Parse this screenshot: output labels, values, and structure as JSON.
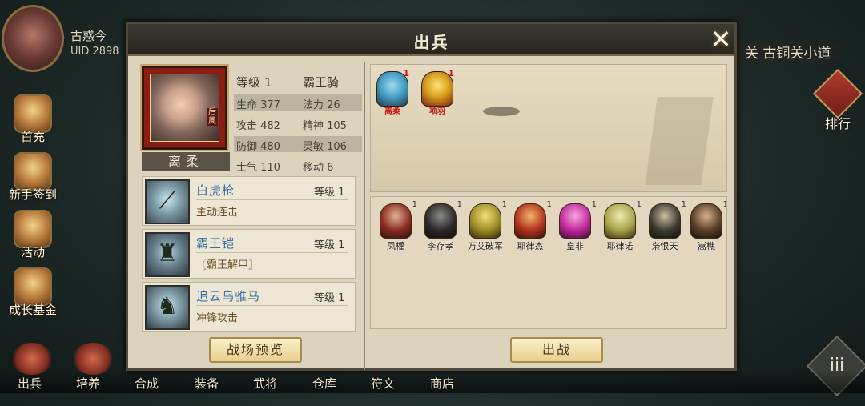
{
  "hud": {
    "player_name": "古惑今",
    "player_uid": "UID 2898",
    "location": "关 古铜关小道",
    "side_buttons": [
      "首充",
      "新手签到",
      "活动",
      "成长基金"
    ],
    "rank_label": "排行",
    "menu_icon": "iii",
    "bottom_nav": [
      "出兵",
      "培养",
      "合成",
      "装备",
      "武将",
      "仓库",
      "符文",
      "商店"
    ]
  },
  "dialog": {
    "title": "出兵",
    "close_icon": "✕",
    "hero": {
      "name": "离柔",
      "portrait_tag": "后\n風",
      "level": "等级 1",
      "unit_type": "霸王骑",
      "stats": [
        {
          "a": "生命 377",
          "b": "法力 26",
          "shaded": true
        },
        {
          "a": "攻击 482",
          "b": "精神 105",
          "shaded": false
        },
        {
          "a": "防御 480",
          "b": "灵敏 106",
          "shaded": true
        },
        {
          "a": "士气 110",
          "b": "移动 6",
          "shaded": false
        }
      ]
    },
    "equipment": [
      {
        "name": "白虎枪",
        "level": "等级 1",
        "desc": "主动连击",
        "icon": "spear-icon",
        "glyph": "⟋"
      },
      {
        "name": "霸王铠",
        "level": "等级 1",
        "desc": "〖霸王解甲〗",
        "icon": "armor-icon",
        "glyph": "♜"
      },
      {
        "name": "追云乌骓马",
        "level": "等级 1",
        "desc": "冲锋攻击",
        "icon": "horse-icon",
        "glyph": "♞"
      }
    ],
    "preview_button": "战场预览",
    "deploy_button": "出战",
    "formation_units": [
      {
        "name": "离柔",
        "count": "1",
        "color": "#4aa3c9"
      },
      {
        "name": "项羽",
        "count": "1",
        "color": "#d9a21f"
      }
    ],
    "roster_units": [
      {
        "name": "凤權",
        "count": "1",
        "color": "#8a2a1f"
      },
      {
        "name": "李存孝",
        "count": "1",
        "color": "#2c2a28"
      },
      {
        "name": "万艾破军",
        "count": "1",
        "color": "#9c8a25"
      },
      {
        "name": "耶律杰",
        "count": "1",
        "color": "#b0321e"
      },
      {
        "name": "皇非",
        "count": "1",
        "color": "#c0289a"
      },
      {
        "name": "耶律诺",
        "count": "1",
        "color": "#a8a24a"
      },
      {
        "name": "枭恨天",
        "count": "1",
        "color": "#3d3a30"
      },
      {
        "name": "嵩樵",
        "count": "1",
        "color": "#5a3f2a"
      }
    ]
  }
}
